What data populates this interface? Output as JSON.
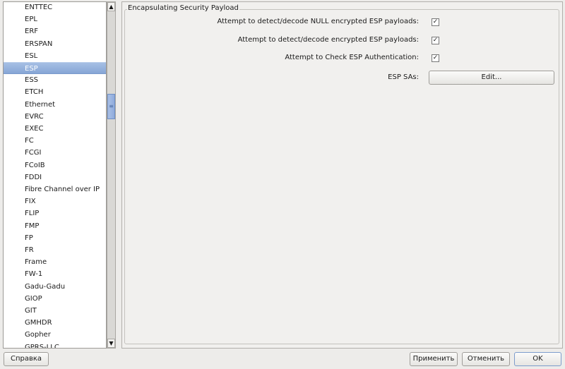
{
  "protocol_list": {
    "items": [
      "ENTTEC",
      "EPL",
      "ERF",
      "ERSPAN",
      "ESL",
      "ESP",
      "ESS",
      "ETCH",
      "Ethernet",
      "EVRC",
      "EXEC",
      "FC",
      "FCGI",
      "FCoIB",
      "FDDI",
      "Fibre Channel over IP",
      "FIX",
      "FLIP",
      "FMP",
      "FP",
      "FR",
      "Frame",
      "FW-1",
      "Gadu-Gadu",
      "GIOP",
      "GIT",
      "GMHDR",
      "Gopher",
      "GPRS-LLC"
    ],
    "selected": "ESP",
    "scroll_position_percent": 26
  },
  "group": {
    "title": "Encapsulating Security Payload",
    "options": [
      {
        "label": "Attempt to detect/decode NULL encrypted ESP payloads:",
        "checked": true
      },
      {
        "label": "Attempt to detect/decode encrypted ESP payloads:",
        "checked": true
      },
      {
        "label": "Attempt to Check ESP Authentication:",
        "checked": true
      }
    ],
    "sas_label": "ESP SAs:",
    "edit_button": "Edit..."
  },
  "buttons": {
    "help": "Справка",
    "apply": "Применить",
    "cancel": "Отменить",
    "ok": "OK"
  },
  "check_glyph": "✓",
  "colors": {
    "selection": "#94b0dc"
  }
}
